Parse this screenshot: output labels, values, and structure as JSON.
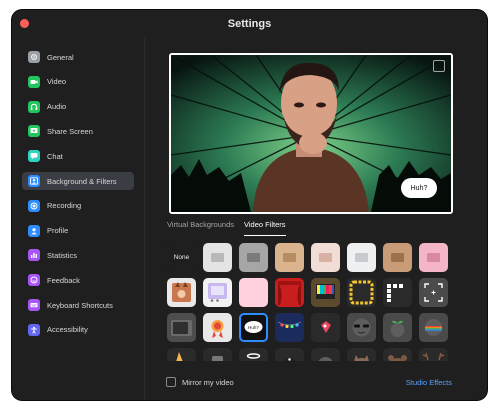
{
  "window": {
    "title": "Settings"
  },
  "sidebar": {
    "items": [
      {
        "label": "General",
        "icon": "gear-icon",
        "color": "#9aa0a6"
      },
      {
        "label": "Video",
        "icon": "video-camera-icon",
        "color": "#22c55e"
      },
      {
        "label": "Audio",
        "icon": "headphones-icon",
        "color": "#22c55e"
      },
      {
        "label": "Share Screen",
        "icon": "share-screen-icon",
        "color": "#22c55e"
      },
      {
        "label": "Chat",
        "icon": "chat-bubble-icon",
        "color": "#2dd4bf"
      },
      {
        "label": "Background & Filters",
        "icon": "background-person-icon",
        "color": "#2d8cff",
        "active": true
      },
      {
        "label": "Recording",
        "icon": "record-icon",
        "color": "#2d8cff"
      },
      {
        "label": "Profile",
        "icon": "profile-icon",
        "color": "#2d8cff"
      },
      {
        "label": "Statistics",
        "icon": "statistics-bars-icon",
        "color": "#a855f7"
      },
      {
        "label": "Feedback",
        "icon": "feedback-smile-icon",
        "color": "#a855f7"
      },
      {
        "label": "Keyboard Shortcuts",
        "icon": "keyboard-icon",
        "color": "#a855f7"
      },
      {
        "label": "Accessibility",
        "icon": "accessibility-icon",
        "color": "#6366f1"
      }
    ]
  },
  "preview": {
    "speech_bubble": "Huh?"
  },
  "tabs": [
    {
      "label": "Virtual Backgrounds",
      "active": false
    },
    {
      "label": "Video Filters",
      "active": true
    }
  ],
  "filters": {
    "none_label": "None",
    "huh_label": "Huh?",
    "tiles": [
      "none",
      "frame-light-gray",
      "frame-gray",
      "frame-tan",
      "frame-pale-pink",
      "frame-white",
      "frame-brown",
      "frame-pink",
      "cat-ears-frame",
      "retro-tv-frame",
      "love-frame",
      "theater-curtain",
      "tv-test-pattern",
      "bubbles-frame",
      "film-strip",
      "viewfinder",
      "old-tv",
      "award-ribbon",
      "speech-bubble-huh",
      "string-lights",
      "hearts-sticker",
      "sunglasses",
      "sprout-head",
      "rainbow",
      "party-hat",
      "hat-gray",
      "halo",
      "pirate",
      "face-mask",
      "cat-face",
      "bear-ears",
      "antlers"
    ]
  },
  "footer": {
    "mirror_label": "Mirror my video",
    "studio_effects_label": "Studio Effects"
  }
}
